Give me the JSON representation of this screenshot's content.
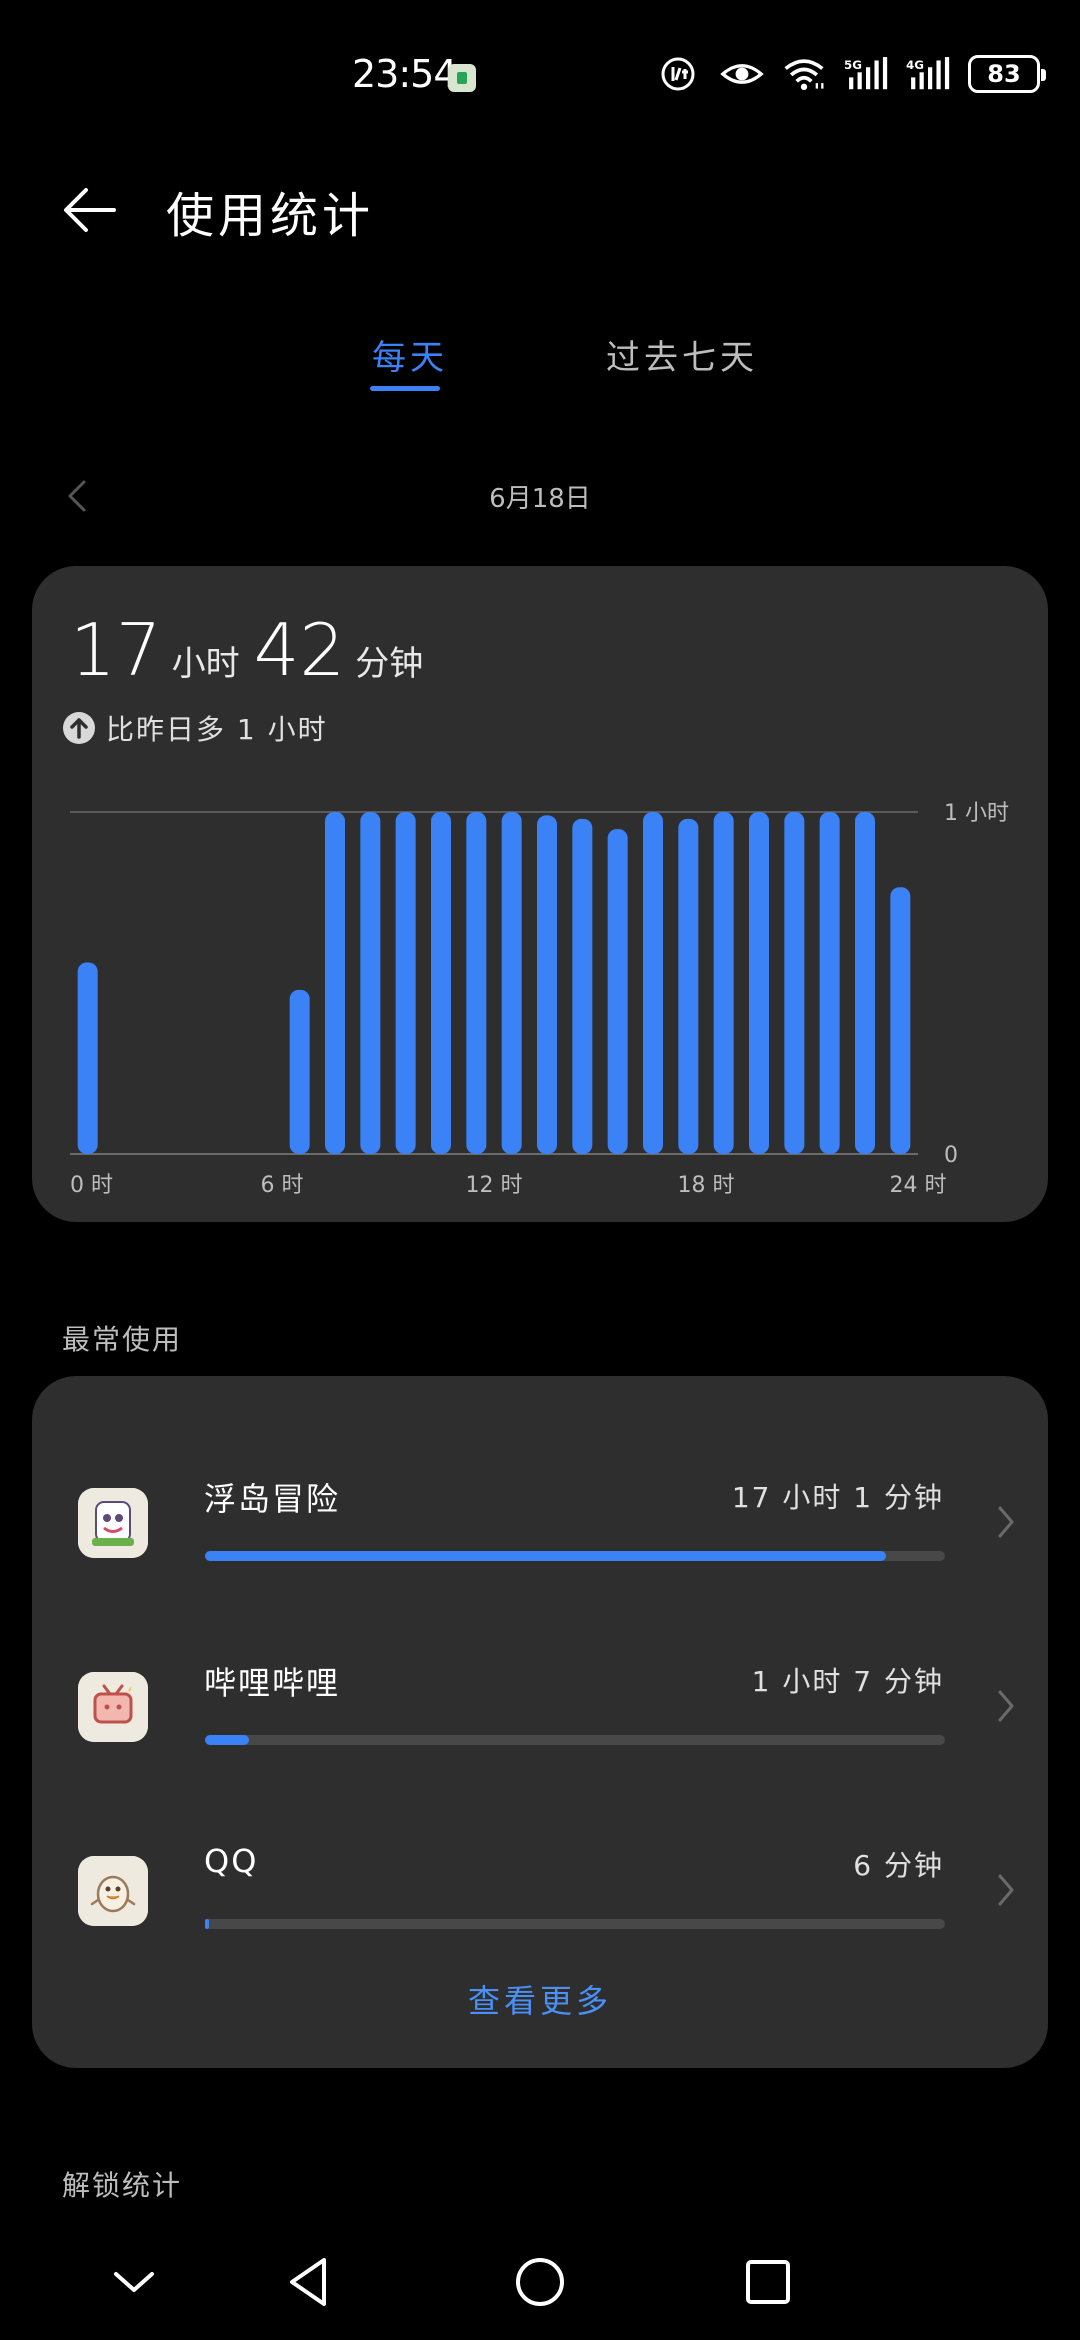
{
  "status": {
    "time": "23:54",
    "battery": "83",
    "network_5g": "5G",
    "network_4g": "4G"
  },
  "header": {
    "title": "使用统计"
  },
  "tabs": {
    "daily": "每天",
    "week": "过去七天"
  },
  "date": "6月18日",
  "usage": {
    "hours_value": "17",
    "hours_unit": "小时",
    "minutes_value": "42",
    "minutes_unit": "分钟",
    "compare_text": "比昨日多 1 小时"
  },
  "chart_data": {
    "type": "bar",
    "categories": [
      "0",
      "1",
      "2",
      "3",
      "4",
      "5",
      "6",
      "7",
      "8",
      "9",
      "10",
      "11",
      "12",
      "13",
      "14",
      "15",
      "16",
      "17",
      "18",
      "19",
      "20",
      "21",
      "22",
      "23"
    ],
    "values": [
      0.56,
      0,
      0,
      0,
      0,
      0,
      0.48,
      1.0,
      1.0,
      1.0,
      1.0,
      1.0,
      1.0,
      0.99,
      0.98,
      0.95,
      1.0,
      0.98,
      1.0,
      1.0,
      1.0,
      1.0,
      1.0,
      0.78
    ],
    "x_tick_labels": [
      "0 时",
      "6 时",
      "12 时",
      "18 时",
      "24 时"
    ],
    "y_tick_labels": [
      "1 小时",
      "0"
    ],
    "ylim": [
      0,
      1
    ],
    "grid": "top line only",
    "bar_color": "#3b82f6"
  },
  "sections": {
    "most_used": "最常使用",
    "unlock": "解锁统计"
  },
  "apps": [
    {
      "name": "浮岛冒险",
      "time": "17 小时 1 分钟",
      "fraction": 0.92,
      "icon": "floating-island-icon"
    },
    {
      "name": "哔哩哔哩",
      "time": "1 小时 7 分钟",
      "fraction": 0.06,
      "icon": "bilibili-tv-icon"
    },
    {
      "name": "QQ",
      "time": "6 分钟",
      "fraction": 0.005,
      "icon": "qq-penguin-icon"
    }
  ],
  "see_more": "查看更多",
  "colors": {
    "accent": "#3b82f6",
    "card": "#2e2e2e",
    "background": "#000000"
  }
}
